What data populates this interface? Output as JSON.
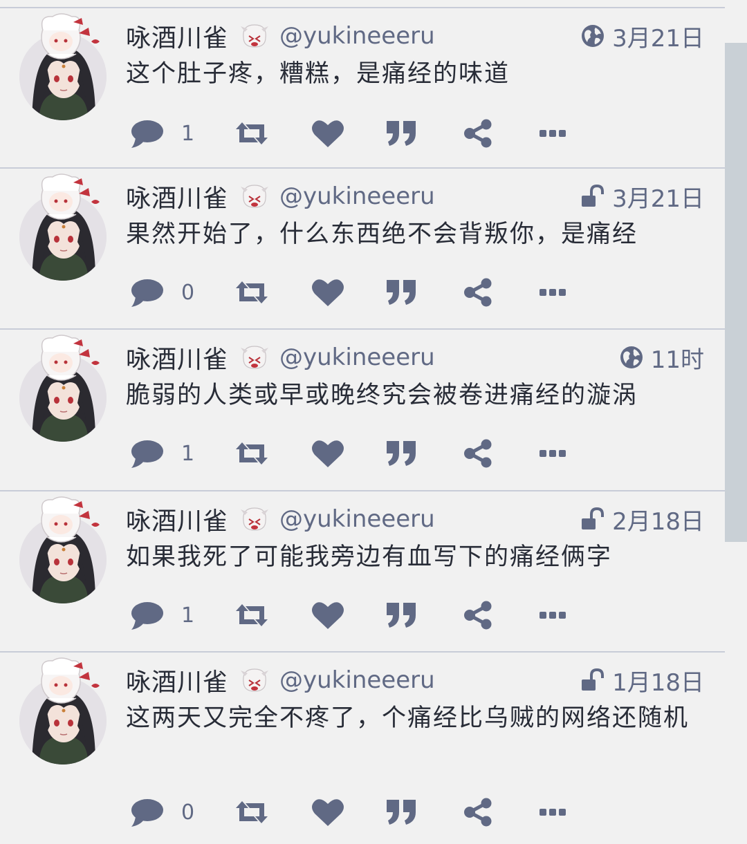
{
  "colors": {
    "background": "#f1f1f1",
    "text": "#282c37",
    "secondary": "#606984",
    "icon": "#606984",
    "divider": "#c8ccd8",
    "scrollbar": "#c9d0d6"
  },
  "statuses": [
    {
      "display_name": "咏酒川雀",
      "handle": "@yukineeeru",
      "visibility_icon": "globe-icon",
      "time": "3月21日",
      "content": "这个肚子疼，糟糕，是痛经的味道",
      "reply_count": "1"
    },
    {
      "display_name": "咏酒川雀",
      "handle": "@yukineeeru",
      "visibility_icon": "unlock-icon",
      "time": "3月21日",
      "content": "果然开始了，什么东西绝不会背叛你，是痛经",
      "reply_count": "0"
    },
    {
      "display_name": "咏酒川雀",
      "handle": "@yukineeeru",
      "visibility_icon": "globe-icon",
      "time": "11时",
      "content": "脆弱的人类或早或晚终究会被卷进痛经的漩涡",
      "reply_count": "1"
    },
    {
      "display_name": "咏酒川雀",
      "handle": "@yukineeeru",
      "visibility_icon": "unlock-icon",
      "time": "2月18日",
      "content": "如果我死了可能我旁边有血写下的痛经俩字",
      "reply_count": "1"
    },
    {
      "display_name": "咏酒川雀",
      "handle": "@yukineeeru",
      "visibility_icon": "unlock-icon",
      "time": "1月18日",
      "content": "这两天又完全不疼了，个痛经比乌贼的网络还随机",
      "reply_count": "0"
    }
  ]
}
